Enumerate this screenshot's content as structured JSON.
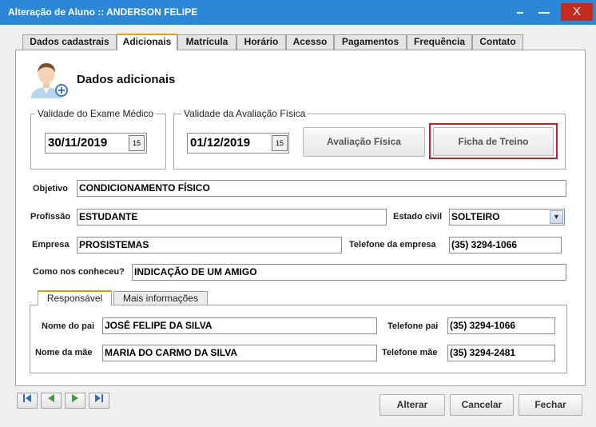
{
  "window": {
    "title": "Alteração de Aluno :: ANDERSON FELIPE",
    "close_glyph": "X"
  },
  "tabs": [
    {
      "label": "Dados cadastrais"
    },
    {
      "label": "Adicionais"
    },
    {
      "label": "Matrícula"
    },
    {
      "label": "Horário"
    },
    {
      "label": "Acesso"
    },
    {
      "label": "Pagamentos"
    },
    {
      "label": "Frequência"
    },
    {
      "label": "Contato"
    }
  ],
  "active_tab": "Adicionais",
  "section": {
    "title": "Dados adicionais",
    "icon": "user-add-icon"
  },
  "exame_medico": {
    "label": "Validade do Exame Médico",
    "date": "30/11/2019"
  },
  "avaliacao_fisica": {
    "label": "Validade da Avaliação Física",
    "date": "01/12/2019",
    "btn_avaliacao": "Avaliação Física",
    "btn_ficha": "Ficha de Treino"
  },
  "form": {
    "objetivo": {
      "label": "Objetivo",
      "value": "CONDICIONAMENTO FÍSICO"
    },
    "profissao": {
      "label": "Profissão",
      "value": "ESTUDANTE"
    },
    "estado_civil": {
      "label": "Estado civil",
      "value": "SOLTEIRO"
    },
    "empresa": {
      "label": "Empresa",
      "value": "PROSISTEMAS"
    },
    "telefone_empresa": {
      "label": "Telefone da empresa",
      "value": "(35) 3294-1066"
    },
    "como_conheceu": {
      "label": "Como nos conheceu?",
      "value": "INDICAÇÃO DE UM AMIGO"
    }
  },
  "subtabs": [
    {
      "label": "Responsável"
    },
    {
      "label": "Mais informações"
    }
  ],
  "responsavel": {
    "nome_pai": {
      "label": "Nome do pai",
      "value": "JOSÉ FELIPE DA SILVA"
    },
    "telefone_pai": {
      "label": "Telefone pai",
      "value": "(35) 3294-1066"
    },
    "nome_mae": {
      "label": "Nome da mãe",
      "value": "MARIA DO CARMO DA SILVA"
    },
    "telefone_mae": {
      "label": "Telefone mãe",
      "value": "(35) 3294-2481"
    }
  },
  "buttons": {
    "alterar": "Alterar",
    "cancelar": "Cancelar",
    "fechar": "Fechar"
  },
  "colors": {
    "titlebar": "#2b88d8",
    "close": "#c42b1c",
    "highlight": "#c81e28",
    "tab_accent": "#e8a000"
  }
}
